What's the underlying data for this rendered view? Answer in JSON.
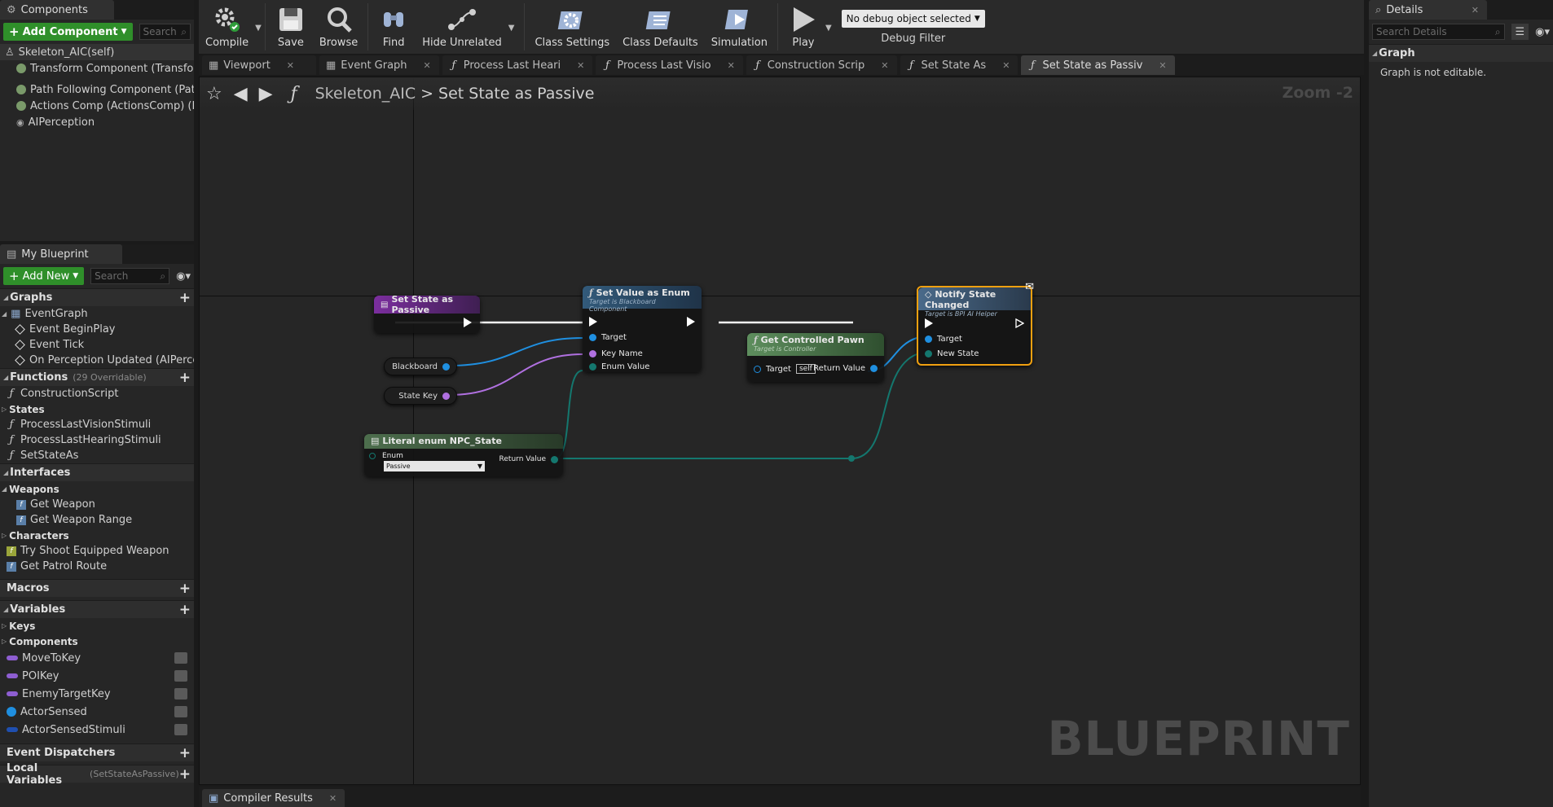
{
  "components": {
    "tab_label": "Components",
    "add_button": "Add Component",
    "search_placeholder": "Search",
    "items": [
      {
        "label": "Skeleton_AIC(self)"
      },
      {
        "label": "Transform Component (TransformComponent)"
      },
      {
        "label": "Path Following Component (PathFollowingComp)"
      },
      {
        "label": "Actions Comp (ActionsComp) (Inherited)"
      },
      {
        "label": "AIPerception"
      }
    ]
  },
  "my_blueprint": {
    "tab_label": "My Blueprint",
    "add_button": "Add New",
    "search_placeholder": "Search",
    "graphs": {
      "label": "Graphs",
      "event_graph": "EventGraph",
      "events": [
        "Event BeginPlay",
        "Event Tick",
        "On Perception Updated (AIPerception)"
      ]
    },
    "functions": {
      "label": "Functions",
      "count": "(29 Overridable)",
      "items": [
        "ConstructionScript"
      ],
      "states_label": "States",
      "state_items": [
        "ProcessLastVisionStimuli",
        "ProcessLastHearingStimuli",
        "SetStateAs"
      ]
    },
    "interfaces": {
      "label": "Interfaces",
      "weapons_label": "Weapons",
      "weapons": [
        "Get Weapon",
        "Get Weapon Range"
      ],
      "characters_label": "Characters",
      "characters": [
        "Try Shoot Equipped Weapon",
        "Get Patrol Route"
      ]
    },
    "macros": {
      "label": "Macros"
    },
    "variables": {
      "label": "Variables",
      "keys_label": "Keys",
      "components_label": "Components",
      "items": [
        {
          "name": "MoveToKey",
          "color": "#8e5ed1"
        },
        {
          "name": "POIKey",
          "color": "#8e5ed1"
        },
        {
          "name": "EnemyTargetKey",
          "color": "#8e5ed1"
        },
        {
          "name": "ActorSensed",
          "color": "#1f8fe0"
        },
        {
          "name": "ActorSensedStimuli",
          "color": "#1f4fb0"
        }
      ]
    },
    "event_dispatchers": {
      "label": "Event Dispatchers"
    },
    "local_variables": {
      "label": "Local Variables",
      "sub": "(SetStateAsPassive)"
    }
  },
  "toolbar": {
    "compile": "Compile",
    "save": "Save",
    "browse": "Browse",
    "find": "Find",
    "hide_unrelated": "Hide Unrelated",
    "class_settings": "Class Settings",
    "class_defaults": "Class Defaults",
    "simulation": "Simulation",
    "play": "Play",
    "debug_select": "No debug object selected",
    "debug_filter": "Debug Filter"
  },
  "graph_tabs": [
    {
      "label": "Viewport"
    },
    {
      "label": "Event Graph"
    },
    {
      "label": "Process Last Heari"
    },
    {
      "label": "Process Last Visio"
    },
    {
      "label": "Construction Scrip"
    },
    {
      "label": "Set State As"
    },
    {
      "label": "Set State as Passiv"
    }
  ],
  "graph": {
    "breadcrumb_root": "Skeleton_AIC",
    "breadcrumb_sep": ">",
    "breadcrumb_current": "Set State as Passive",
    "zoom": "Zoom -2",
    "watermark": "BLUEPRINT",
    "nodes": {
      "entry": {
        "title": "Set State as Passive"
      },
      "set_value": {
        "title": "Set Value as Enum",
        "subtitle": "Target is Blackboard Component",
        "pins": [
          "Target",
          "Key Name",
          "Enum Value"
        ]
      },
      "get_pawn": {
        "title": "Get Controlled Pawn",
        "subtitle": "Target is Controller",
        "target": "Target",
        "self": "self",
        "return": "Return Value"
      },
      "notify": {
        "title": "Notify State Changed",
        "subtitle": "Target is BPI AI Helper",
        "pins": [
          "Target",
          "New State"
        ]
      },
      "blackboard": {
        "label": "Blackboard"
      },
      "state_key": {
        "label": "State Key"
      },
      "literal": {
        "title": "Literal enum NPC_State",
        "enum_label": "Enum",
        "enum_value": "Passive",
        "return": "Return Value"
      }
    }
  },
  "details": {
    "tab_label": "Details",
    "search_placeholder": "Search Details",
    "section": "Graph",
    "message": "Graph is not editable."
  },
  "bottom": {
    "compiler_results": "Compiler Results"
  }
}
